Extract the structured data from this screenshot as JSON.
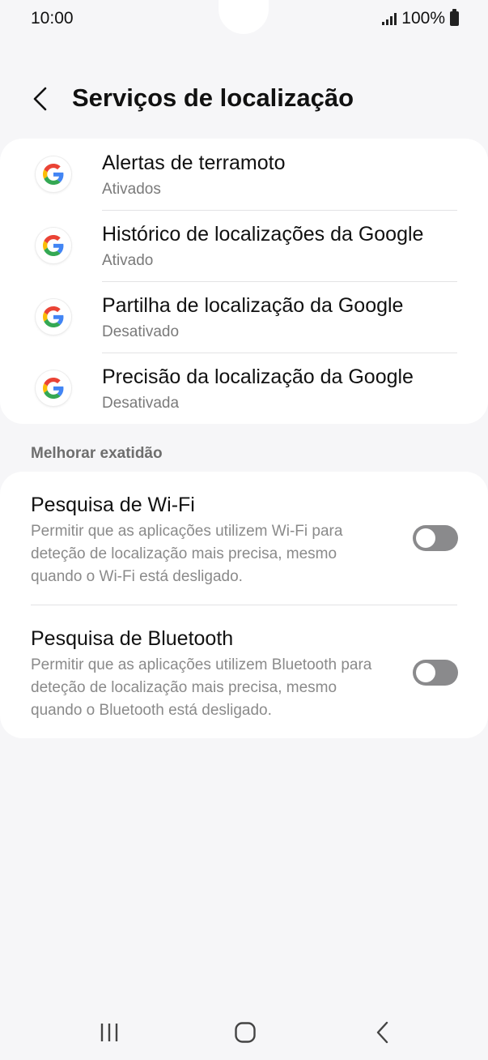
{
  "status_bar": {
    "time": "10:00",
    "battery": "100%",
    "icons": [
      "signal-icon",
      "battery-icon"
    ]
  },
  "header": {
    "title": "Serviços de localização",
    "back_icon": "chevron-left-icon"
  },
  "google_services": [
    {
      "title": "Alertas de terramoto",
      "status": "Ativados",
      "icon": "google-g-icon"
    },
    {
      "title": "Histórico de localizações da Google",
      "status": "Ativado",
      "icon": "google-g-icon"
    },
    {
      "title": "Partilha de localização da Google",
      "status": "Desativado",
      "icon": "google-g-icon"
    },
    {
      "title": "Precisão da localização da Google",
      "status": "Desativada",
      "icon": "google-g-icon"
    }
  ],
  "improve_section": {
    "label": "Melhorar exatidão",
    "items": [
      {
        "title": "Pesquisa de Wi-Fi",
        "description": "Permitir que as aplicações utilizem Wi-Fi para deteção de localização mais precisa, mesmo quando o Wi-Fi está desligado.",
        "enabled": false
      },
      {
        "title": "Pesquisa de Bluetooth",
        "description": "Permitir que as aplicações utilizem Bluetooth para deteção de localização mais precisa, mesmo quando o Bluetooth está desligado.",
        "enabled": false
      }
    ]
  },
  "nav_bar": {
    "buttons": [
      "recents-icon",
      "home-icon",
      "back-icon"
    ]
  },
  "colors": {
    "background": "#f6f6f8",
    "card": "#ffffff",
    "switch_off": "#8a8a8c"
  }
}
